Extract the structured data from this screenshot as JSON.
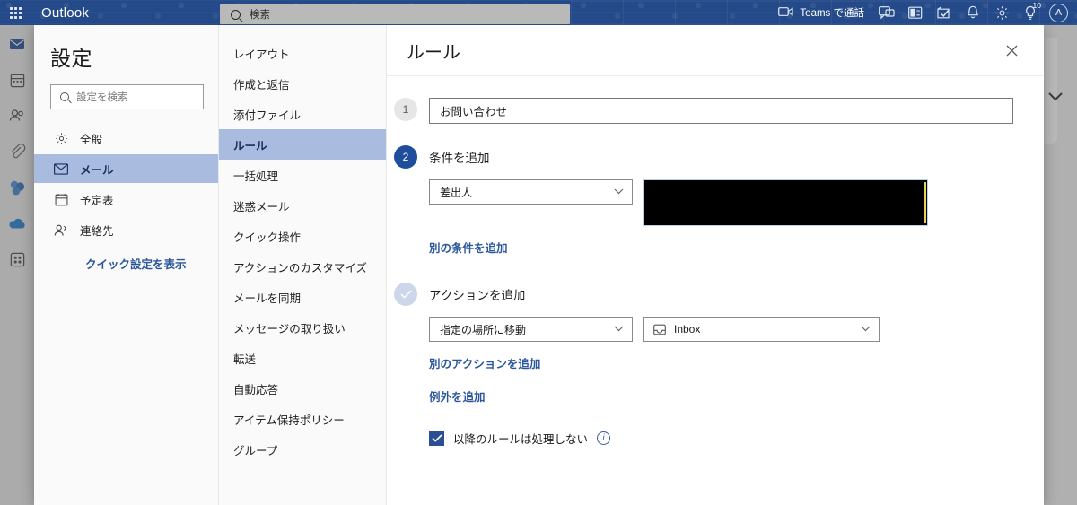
{
  "suite": {
    "app_launcher": "waffle-icon",
    "brand": "Outlook",
    "search_placeholder": "検索",
    "teams_call_label": "Teams で通話",
    "notification_badge": "10",
    "avatar_initial": "A",
    "icons": [
      "video-camera-icon",
      "chat-icon",
      "office-app-icon",
      "tasks-icon",
      "bell-icon",
      "gear-icon",
      "lightbulb-icon"
    ]
  },
  "rail": {
    "items": [
      {
        "name": "mail-icon",
        "selected": true
      },
      {
        "name": "calendar-icon",
        "selected": false
      },
      {
        "name": "people-icon",
        "selected": false
      },
      {
        "name": "attachment-icon",
        "selected": false
      },
      {
        "name": "teams-icon",
        "selected": false
      },
      {
        "name": "onedrive-icon",
        "selected": false
      },
      {
        "name": "apps-grid-icon",
        "selected": false
      }
    ]
  },
  "settings": {
    "title": "設定",
    "search_placeholder": "設定を検索",
    "nav": [
      {
        "label": "全般",
        "icon": "gear-icon",
        "selected": false
      },
      {
        "label": "メール",
        "icon": "mail-icon",
        "selected": true
      },
      {
        "label": "予定表",
        "icon": "calendar-icon",
        "selected": false
      },
      {
        "label": "連絡先",
        "icon": "people-icon",
        "selected": false
      }
    ],
    "quick_settings_link": "クイック設定を表示"
  },
  "sub_nav": {
    "items": [
      {
        "label": "レイアウト",
        "selected": false
      },
      {
        "label": "作成と返信",
        "selected": false
      },
      {
        "label": "添付ファイル",
        "selected": false
      },
      {
        "label": "ルール",
        "selected": true
      },
      {
        "label": "一括処理",
        "selected": false
      },
      {
        "label": "迷惑メール",
        "selected": false
      },
      {
        "label": "クイック操作",
        "selected": false
      },
      {
        "label": "アクションのカスタマイズ",
        "selected": false
      },
      {
        "label": "メールを同期",
        "selected": false
      },
      {
        "label": "メッセージの取り扱い",
        "selected": false
      },
      {
        "label": "転送",
        "selected": false
      },
      {
        "label": "自動応答",
        "selected": false
      },
      {
        "label": "アイテム保持ポリシー",
        "selected": false
      },
      {
        "label": "グループ",
        "selected": false
      }
    ]
  },
  "pane": {
    "title": "ルール",
    "close_label": "✕",
    "step1": {
      "number": "1",
      "rule_name_value": "お問い合わせ"
    },
    "step2": {
      "number": "2",
      "heading": "条件を追加",
      "condition_type": "差出人",
      "condition_value": "",
      "add_condition_link": "別の条件を追加"
    },
    "step3": {
      "check_glyph": "✓",
      "heading": "アクションを追加",
      "action_type": "指定の場所に移動",
      "action_target": "Inbox",
      "action_target_icon": "inbox-icon",
      "add_action_link": "別のアクションを追加",
      "add_exception_link": "例外を追加"
    },
    "stop_processing": {
      "label": "以降のルールは処理しない",
      "checked": true,
      "info_glyph": "i"
    }
  },
  "colors": {
    "suite_bar": "#254a89",
    "accent_blue": "#1f4e9c",
    "link_blue": "#2b579a",
    "selection_blue": "#a9bce0"
  }
}
